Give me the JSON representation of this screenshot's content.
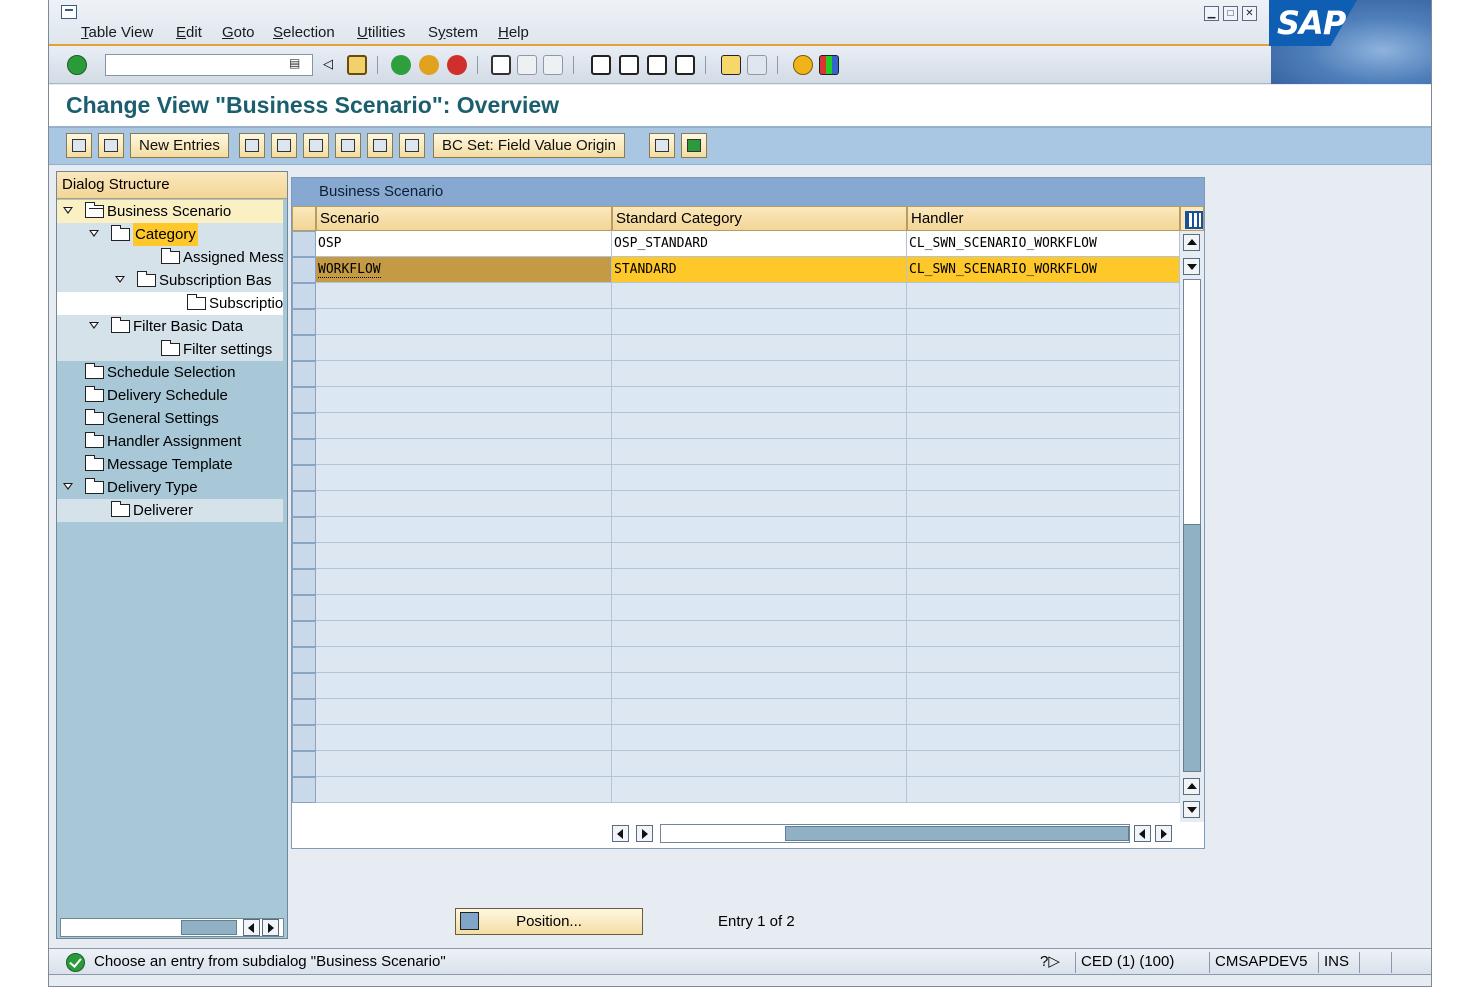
{
  "menu": {
    "items": [
      {
        "label": "Table View",
        "underline": "T"
      },
      {
        "label": "Edit",
        "underline": "E"
      },
      {
        "label": "Goto",
        "underline": "G"
      },
      {
        "label": "Selection",
        "underline": "S"
      },
      {
        "label": "Utilities",
        "underline": "U"
      },
      {
        "label": "System",
        "underline": "y"
      },
      {
        "label": "Help",
        "underline": "H"
      }
    ]
  },
  "window_buttons": {
    "minimize": "▁",
    "maximize": "□",
    "close": "✕"
  },
  "brand": {
    "logo_text": "SAP",
    "color": "#0e5fb4"
  },
  "command_field": {
    "value": ""
  },
  "title": {
    "text": "Change View \"Business Scenario\": Overview"
  },
  "app_toolbar": {
    "new_entries": "New Entries",
    "bc_set": "BC Set: Field Value Origin"
  },
  "tree": {
    "header": "Dialog Structure",
    "nodes": [
      {
        "label": "Business Scenario",
        "level": 0,
        "expanded": true,
        "open": true,
        "selected": false,
        "highlight": true
      },
      {
        "label": "Category",
        "level": 1,
        "expanded": true,
        "selected": true
      },
      {
        "label": "Assigned Messa",
        "level": 3
      },
      {
        "label": "Subscription Bas",
        "level": 2,
        "expanded": true
      },
      {
        "label": "Subscription :",
        "level": 4
      },
      {
        "label": "Filter Basic Data",
        "level": 1,
        "expanded": true
      },
      {
        "label": "Filter settings",
        "level": 3
      },
      {
        "label": "Schedule Selection",
        "level": 0
      },
      {
        "label": "Delivery Schedule",
        "level": 0
      },
      {
        "label": "General Settings",
        "level": 0
      },
      {
        "label": "Handler Assignment",
        "level": 0
      },
      {
        "label": "Message Template",
        "level": 0
      },
      {
        "label": "Delivery Type",
        "level": 0,
        "expanded": true
      },
      {
        "label": "Deliverer",
        "level": 1
      }
    ]
  },
  "table": {
    "title": "Business Scenario",
    "columns": [
      "Scenario",
      "Standard Category",
      "Handler"
    ],
    "rows": [
      {
        "scenario": "OSP",
        "category": "OSP_STANDARD",
        "handler": "CL_SWN_SCENARIO_WORKFLOW",
        "selected": false
      },
      {
        "scenario": "WORKFLOW",
        "category": "STANDARD",
        "handler": "CL_SWN_SCENARIO_WORKFLOW",
        "selected": true
      }
    ],
    "visible_rows": 22
  },
  "position_button": {
    "label": "Position..."
  },
  "entry_info": {
    "text": "Entry 1 of 2"
  },
  "status": {
    "message": "Choose an entry from subdialog \"Business Scenario\"",
    "system": "CED (1) (100)",
    "server": "CMSAPDEV5",
    "mode": "INS"
  },
  "colors": {
    "accent_orange": "#e6a234",
    "selected_row": "#ffc82a",
    "tree_bg": "#a8c8d8",
    "app_toolbar": "#a9c6e2",
    "title_color": "#1b5f6f"
  }
}
